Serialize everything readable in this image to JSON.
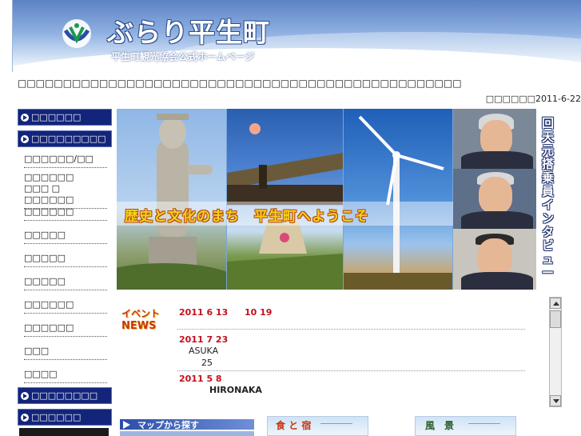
{
  "header": {
    "title": "ぶらり平生町",
    "subtitle": "平生町観光協会公式ホームページ"
  },
  "notice": "□□□□□□□□□□□□□□□□□□□□□□□□□□□□□□□□□□□□□□□□□□□□□□□□□",
  "update_date": "□□□□□□2011-6-22",
  "sidebar": {
    "head1": "□□□□□□",
    "head2": "□□□□□□□□□",
    "links": [
      "□□□□□□/□□",
      "□□□□□□\n□□□ □ □□□□□□",
      "□□□□□□",
      "□□□□□",
      "□□□□□",
      "□□□□□",
      "□□□□□□",
      "□□□□□□",
      "□□□",
      "□□□□"
    ],
    "head3": "□□□□□□□□",
    "head4": "□□□□□□"
  },
  "banner": {
    "caption": "歴史と文化のまち　平生町へようこそ",
    "interview": "回天元搭乗員インタビュー"
  },
  "news": {
    "logo_line1": "イベント",
    "logo_line2": "NEWS",
    "items": [
      {
        "date": "2011  6  13",
        "title": "10  19",
        "body": "",
        "body2": ""
      },
      {
        "date": "2011  7  23",
        "title": "",
        "body": "ASUKA",
        "body2": "25"
      },
      {
        "date": "2011  5  8",
        "title": "",
        "body": "HIRONAKA",
        "body2": ""
      }
    ]
  },
  "bottom": {
    "map": "マップから探す",
    "food": "食 と 宿",
    "scenery": "風　景"
  },
  "colors": {
    "nav_bg": "#13257a",
    "news_red": "#c0121c",
    "header_blue": "#5b82c4"
  }
}
